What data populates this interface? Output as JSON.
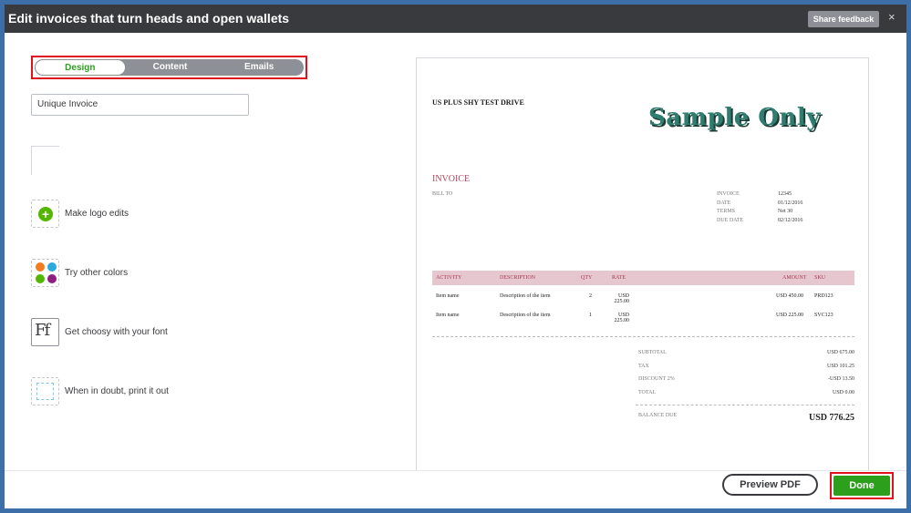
{
  "header": {
    "title": "Edit invoices that turn heads and open wallets",
    "share_feedback": "Share feedback",
    "close_glyph": "×"
  },
  "tabs": [
    {
      "label": "Design",
      "active": true
    },
    {
      "label": "Content",
      "active": false
    },
    {
      "label": "Emails",
      "active": false
    }
  ],
  "template_name": {
    "value": "Unique Invoice"
  },
  "options": [
    {
      "label": "Make logo edits",
      "icon": "plus-icon"
    },
    {
      "label": "Try other colors",
      "icon": "color-dots-icon"
    },
    {
      "label": "Get choosy with your font",
      "icon": "font-icon"
    },
    {
      "label": "When in doubt, print it out",
      "icon": "print-icon"
    }
  ],
  "colors": {
    "accent_green": "#2ca01c",
    "dot_colors": [
      "#f37b21",
      "#2ca8e0",
      "#53b700",
      "#8e1f7f"
    ]
  },
  "invoice": {
    "company": "US PLUS SHY TEST DRIVE",
    "watermark": "Sample Only",
    "title": "INVOICE",
    "bill_to": "BILL TO",
    "meta": [
      {
        "k": "INVOICE",
        "v": "12345"
      },
      {
        "k": "DATE",
        "v": "01/12/2016"
      },
      {
        "k": "TERMS",
        "v": "Net 30"
      },
      {
        "k": "DUE DATE",
        "v": "02/12/2016"
      }
    ],
    "columns": {
      "activity": "ACTIVITY",
      "description": "DESCRIPTION",
      "qty": "QTY",
      "rate": "RATE",
      "amount": "AMOUNT",
      "sku": "SKU"
    },
    "items": [
      {
        "activity": "Item name",
        "description": "Description of the item",
        "qty": "2",
        "rate": "USD 225.00",
        "amount": "USD 450.00",
        "sku": "PRD123"
      },
      {
        "activity": "Item name",
        "description": "Description of the item",
        "qty": "1",
        "rate": "USD 225.00",
        "amount": "USD 225.00",
        "sku": "SVC123"
      }
    ],
    "totals": [
      {
        "k": "SUBTOTAL",
        "v": "USD 675.00"
      },
      {
        "k": "TAX",
        "v": "USD 101.25"
      },
      {
        "k": "DISCOUNT 2%",
        "v": "-USD 13.50"
      },
      {
        "k": "TOTAL",
        "v": "USD 0.00"
      }
    ],
    "balance_due": {
      "k": "BALANCE DUE",
      "v": "USD 776.25"
    }
  },
  "footer": {
    "preview_pdf": "Preview PDF",
    "done": "Done"
  }
}
